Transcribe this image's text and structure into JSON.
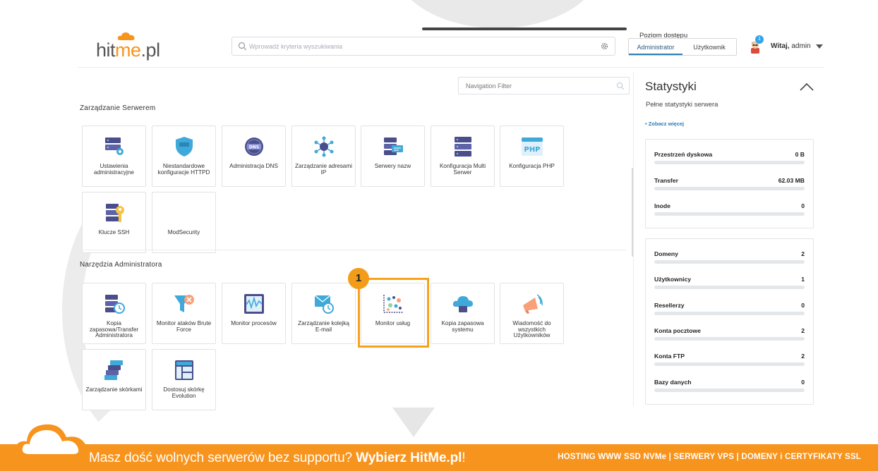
{
  "header": {
    "logo_prefix": "hit",
    "logo_me": "me",
    "logo_suffix": ".pl",
    "search_placeholder": "Wprowadź kryteria wyszukiwania",
    "access_label": "Poziom dostępu",
    "access_levels": [
      "Administrator",
      "Użytkownik"
    ],
    "active_access": "Administrator",
    "notification_count": "1",
    "welcome_prefix": "Witaj,",
    "welcome_user": "admin"
  },
  "nav_filter": {
    "placeholder": "Navigation Filter"
  },
  "sections": [
    {
      "title": "Zarządzanie Serwerem",
      "tiles": [
        {
          "label": "Ustawienia administracyjne",
          "icon": "server-settings-icon"
        },
        {
          "label": "Niestandardowe konfiguracje HTTPD",
          "icon": "shield-httpd-icon"
        },
        {
          "label": "Administracja DNS",
          "icon": "dns-icon"
        },
        {
          "label": "Zarządzanie adresami IP",
          "icon": "ip-network-icon"
        },
        {
          "label": "Serwery nazw",
          "icon": "name-servers-icon"
        },
        {
          "label": "Konfiguracja Multi Serwer",
          "icon": "multi-server-icon"
        },
        {
          "label": "Konfiguracja PHP",
          "icon": "php-icon"
        },
        {
          "label": "Klucze SSH",
          "icon": "ssh-key-icon"
        },
        {
          "label": "ModSecurity",
          "icon": ""
        }
      ]
    },
    {
      "title": "Narzędzia Administratora",
      "tiles": [
        {
          "label": "Kopia zapasowa/Transfer Administratora",
          "icon": "backup-transfer-icon"
        },
        {
          "label": "Monitor ataków Brute Force",
          "icon": "brute-force-icon"
        },
        {
          "label": "Monitor procesów",
          "icon": "process-monitor-icon"
        },
        {
          "label": "Zarządzanie kolejką E-mail",
          "icon": "mail-queue-icon"
        },
        {
          "label": "Monitor usług",
          "icon": "service-monitor-icon"
        },
        {
          "label": "Kopia zapasowa systemu",
          "icon": "cloud-backup-icon"
        },
        {
          "label": "Wiadomość do wszystkich Użytkowników",
          "icon": "megaphone-icon"
        },
        {
          "label": "Zarządzanie skórkami",
          "icon": "skins-icon"
        },
        {
          "label": "Dostosuj skórkę Evolution",
          "icon": "layout-icon"
        }
      ]
    }
  ],
  "highlight_marker": "1",
  "stats": {
    "title": "Statystyki",
    "subtitle": "Pełne statystyki serwera",
    "more_link": "• Zobacz więcej",
    "card1": [
      {
        "name": "Przestrzeń dyskowa",
        "value": "0 B"
      },
      {
        "name": "Transfer",
        "value": "62.03 MB"
      },
      {
        "name": "Inode",
        "value": "0"
      }
    ],
    "card2": [
      {
        "name": "Domeny",
        "value": "2"
      },
      {
        "name": "Użytkownicy",
        "value": "1"
      },
      {
        "name": "Resellerzy",
        "value": "0"
      },
      {
        "name": "Konta pocztowe",
        "value": "2"
      },
      {
        "name": "Konta FTP",
        "value": "2"
      },
      {
        "name": "Bazy danych",
        "value": "0"
      }
    ]
  },
  "footer": {
    "text": "Masz dość wolnych serwerów bez supportu?",
    "strong": "Wybierz HitMe.pl",
    "excl": "!",
    "right": "HOSTING WWW SSD NVMe | SERWERY VPS | DOMENY i CERTYFIKATY SSL"
  },
  "colors": {
    "brand_orange": "#f7941d",
    "accent_blue": "#2c7fb8"
  }
}
